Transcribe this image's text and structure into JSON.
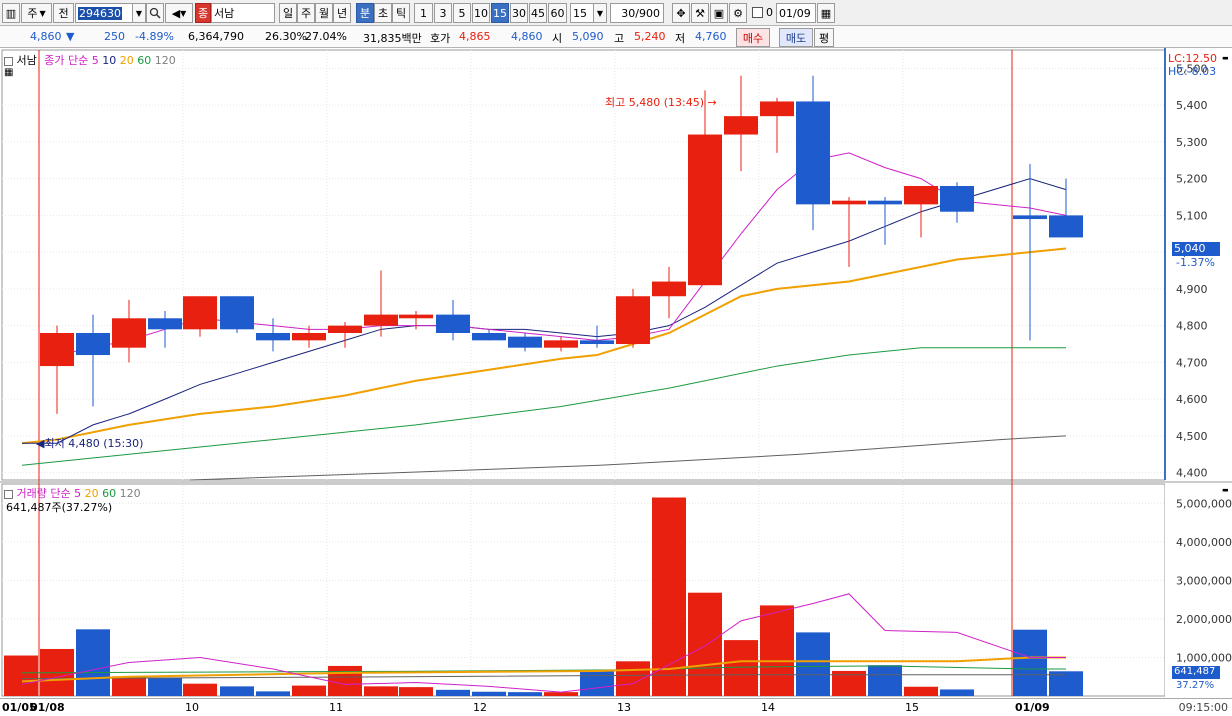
{
  "toolbar": {
    "market_label": "주",
    "price_type_label": "전",
    "code_value": "294630",
    "stock_badge": "종",
    "stock_name": "서남",
    "periods": [
      "일",
      "주",
      "월",
      "년",
      "분",
      "초",
      "틱"
    ],
    "selected_period": "분",
    "intervals": [
      "1",
      "3",
      "5",
      "10",
      "15",
      "30",
      "45",
      "60"
    ],
    "selected_interval": "15",
    "interval_select_value": "15",
    "count_value": "30/900",
    "checkbox_label": "0",
    "date_value": "01/09"
  },
  "quote": {
    "price": "4,860",
    "change_arrow": "▼",
    "change": "250",
    "change_pct": "-4.89%",
    "volume": "6,364,790",
    "turnover_pct": "26.30%",
    "ratio_pct": "27.04%",
    "amount": "31,835백만",
    "ask_label": "호가",
    "ask": "4,865",
    "bid": "4,860",
    "open_label": "시",
    "open": "5,090",
    "high_label": "고",
    "high": "5,240",
    "low_label": "저",
    "low": "4,760",
    "buy_label": "매수",
    "sell_label": "매도",
    "eval_label": "평"
  },
  "price_panel": {
    "stock_label": "서남",
    "ma_label": "종가 단순",
    "ma_periods": [
      "5",
      "10",
      "20",
      "60",
      "120"
    ],
    "lc_label": "LC:12.50",
    "hc_label": "HC:-8.03",
    "current_price_tag": "5,040",
    "current_pct_tag": "-1.37%",
    "high_annotation": "최고 5,480 (13:45)",
    "low_annotation": "최저 4,480 (15:30)"
  },
  "volume_panel": {
    "label": "거래량",
    "ma_label": "단순",
    "ma_periods": [
      "5",
      "20",
      "60",
      "120"
    ],
    "info": "641,487주(37.27%)",
    "current_tag": "641,487",
    "current_pct_tag": "37.27%"
  },
  "x_axis": {
    "labels": [
      "01/05",
      "01/08",
      "10",
      "11",
      "12",
      "13",
      "14",
      "15",
      "01/09"
    ],
    "time_label": "09:15:00"
  },
  "colors": {
    "up": "#e8200f",
    "down": "#1e5bcc",
    "ma5": "#d020c8",
    "ma10": "#1a237e",
    "ma20": "#f0a000",
    "ma60": "#1a9a40",
    "ma120": "#606060"
  },
  "chart_data": {
    "type": "candlestick",
    "price_ticks": [
      4400,
      4500,
      4600,
      4700,
      4800,
      4900,
      5000,
      5100,
      5200,
      5300,
      5400,
      5500
    ],
    "price_range": [
      4380,
      5550
    ],
    "candles": [
      {
        "o": 4690,
        "h": 4800,
        "l": 4560,
        "c": 4780
      },
      {
        "o": 4780,
        "h": 4830,
        "l": 4580,
        "c": 4720
      },
      {
        "o": 4740,
        "h": 4870,
        "l": 4700,
        "c": 4820
      },
      {
        "o": 4820,
        "h": 4840,
        "l": 4740,
        "c": 4790
      },
      {
        "o": 4790,
        "h": 4880,
        "l": 4770,
        "c": 4880
      },
      {
        "o": 4880,
        "h": 4880,
        "l": 4780,
        "c": 4790
      },
      {
        "o": 4780,
        "h": 4820,
        "l": 4730,
        "c": 4760
      },
      {
        "o": 4760,
        "h": 4800,
        "l": 4740,
        "c": 4780
      },
      {
        "o": 4780,
        "h": 4810,
        "l": 4740,
        "c": 4800
      },
      {
        "o": 4800,
        "h": 4950,
        "l": 4770,
        "c": 4830
      },
      {
        "o": 4820,
        "h": 4840,
        "l": 4790,
        "c": 4830
      },
      {
        "o": 4830,
        "h": 4870,
        "l": 4760,
        "c": 4780
      },
      {
        "o": 4780,
        "h": 4790,
        "l": 4760,
        "c": 4760
      },
      {
        "o": 4770,
        "h": 4780,
        "l": 4730,
        "c": 4740
      },
      {
        "o": 4740,
        "h": 4770,
        "l": 4730,
        "c": 4760
      },
      {
        "o": 4760,
        "h": 4800,
        "l": 4740,
        "c": 4750
      },
      {
        "o": 4750,
        "h": 4900,
        "l": 4740,
        "c": 4880
      },
      {
        "o": 4880,
        "h": 4960,
        "l": 4820,
        "c": 4920
      },
      {
        "o": 4910,
        "h": 5440,
        "l": 4910,
        "c": 5320
      },
      {
        "o": 5320,
        "h": 5480,
        "l": 5220,
        "c": 5370
      },
      {
        "o": 5370,
        "h": 5420,
        "l": 5270,
        "c": 5410
      },
      {
        "o": 5410,
        "h": 5480,
        "l": 5060,
        "c": 5130
      },
      {
        "o": 5130,
        "h": 5150,
        "l": 4960,
        "c": 5140
      },
      {
        "o": 5140,
        "h": 5150,
        "l": 5020,
        "c": 5130
      },
      {
        "o": 5130,
        "h": 5180,
        "l": 5040,
        "c": 5180
      },
      {
        "o": 5180,
        "h": 5190,
        "l": 5080,
        "c": 5110
      },
      {
        "o": 5100,
        "h": 5240,
        "l": 4760,
        "c": 5090
      },
      {
        "o": 5100,
        "h": 5200,
        "l": 5040,
        "c": 5040
      }
    ],
    "candle_x": [
      57,
      93,
      129,
      165,
      200,
      237,
      273,
      309,
      345,
      381,
      416,
      453,
      489,
      525,
      561,
      597,
      633,
      669,
      705,
      741,
      777,
      813,
      849,
      885,
      921,
      957,
      1030,
      1066
    ],
    "ma5": {
      "x": [
        57,
        93,
        129,
        165,
        200,
        237,
        273,
        309,
        345,
        381,
        416,
        453,
        489,
        525,
        561,
        597,
        633,
        669,
        705,
        741,
        777,
        813,
        849,
        885,
        921,
        957,
        1030,
        1066
      ],
      "y": [
        4720,
        4740,
        4760,
        4790,
        4820,
        4810,
        4800,
        4790,
        4790,
        4800,
        4800,
        4800,
        4790,
        4780,
        4770,
        4760,
        4770,
        4790,
        4920,
        5050,
        5170,
        5250,
        5270,
        5230,
        5200,
        5140,
        5120,
        5100
      ]
    },
    "ma10": {
      "x": [
        22,
        57,
        93,
        129,
        165,
        200,
        237,
        273,
        309,
        345,
        381,
        416,
        453,
        489,
        525,
        561,
        597,
        633,
        669,
        705,
        741,
        777,
        813,
        849,
        885,
        921,
        1030,
        1066
      ],
      "y": [
        4480,
        4480,
        4530,
        4560,
        4600,
        4640,
        4670,
        4700,
        4730,
        4760,
        4790,
        4800,
        4800,
        4790,
        4790,
        4780,
        4770,
        4780,
        4800,
        4850,
        4910,
        4970,
        5000,
        5030,
        5070,
        5110,
        5200,
        5170
      ]
    },
    "ma20": {
      "x": [
        22,
        57,
        129,
        200,
        273,
        345,
        416,
        489,
        561,
        597,
        633,
        669,
        705,
        741,
        777,
        849,
        921,
        957,
        1030,
        1066
      ],
      "y": [
        4480,
        4490,
        4530,
        4560,
        4580,
        4610,
        4650,
        4680,
        4710,
        4720,
        4750,
        4780,
        4830,
        4880,
        4900,
        4920,
        4960,
        4980,
        5000,
        5010
      ]
    },
    "ma60": {
      "x": [
        22,
        129,
        273,
        416,
        561,
        669,
        777,
        849,
        921,
        957,
        1030,
        1066
      ],
      "y": [
        4420,
        4450,
        4490,
        4530,
        4580,
        4630,
        4690,
        4720,
        4740,
        4740,
        4740,
        4740
      ]
    },
    "ma120": {
      "x": [
        190,
        400,
        600,
        800,
        1000,
        1066
      ],
      "y": [
        4380,
        4400,
        4420,
        4450,
        4490,
        4500
      ]
    },
    "volume_ticks": [
      1000,
      2000,
      3000,
      4000,
      5000
    ],
    "volume_range": [
      0,
      5500
    ],
    "volumes": [
      1050,
      1220,
      1730,
      510,
      480,
      320,
      250,
      120,
      270,
      780,
      250,
      230,
      160,
      110,
      100,
      100,
      650,
      900,
      5150,
      2680,
      1450,
      2350,
      1650,
      650,
      800,
      240,
      170,
      1720,
      641
    ],
    "volume_x": [
      21,
      57,
      93,
      129,
      165,
      200,
      237,
      273,
      309,
      345,
      381,
      416,
      453,
      489,
      525,
      561,
      597,
      633,
      669,
      705,
      741,
      777,
      813,
      849,
      885,
      921,
      957,
      1030,
      1066
    ],
    "volume_ma5": {
      "x": [
        22,
        129,
        200,
        273,
        345,
        416,
        489,
        561,
        633,
        705,
        741,
        813,
        849,
        885,
        957,
        1030,
        1066
      ],
      "y": [
        300,
        870,
        1000,
        700,
        300,
        350,
        250,
        100,
        320,
        1300,
        1950,
        2400,
        2650,
        1700,
        1650,
        1000,
        1000
      ]
    },
    "volume_ma20": {
      "x": [
        22,
        129,
        345,
        597,
        669,
        741,
        849,
        957,
        1030,
        1066
      ],
      "y": [
        380,
        500,
        600,
        650,
        700,
        900,
        900,
        900,
        1000,
        1000
      ]
    },
    "volume_ma60": {
      "x": [
        22,
        200,
        400,
        633,
        741,
        885,
        1030,
        1066
      ],
      "y": [
        600,
        620,
        640,
        680,
        750,
        780,
        700,
        700
      ]
    },
    "volume_ma120": {
      "x": [
        22,
        400,
        741,
        1066
      ],
      "y": [
        450,
        500,
        550,
        550
      ]
    }
  }
}
